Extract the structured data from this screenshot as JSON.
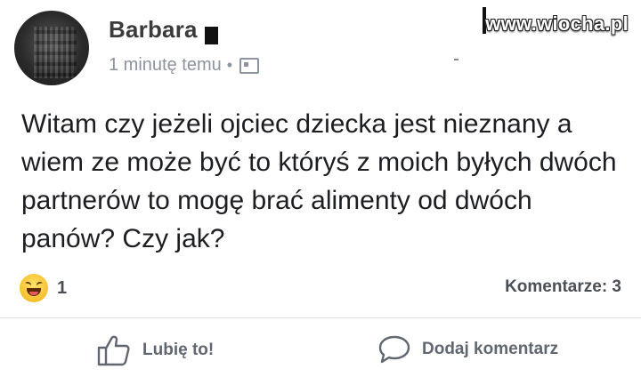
{
  "post": {
    "author": "Barbara",
    "timestamp": "1 minutę temu",
    "separator": "•",
    "audience_icon": "image-icon",
    "body": "Witam czy jeżeli ojciec dziecka jest nieznany a wiem ze może być to któryś z moich byłych dwóch partnerów to mogę brać alimenty od dwóch panów? Czy jak?",
    "watermark": "www.wiocha.pl"
  },
  "stats": {
    "reaction_icon": "haha-emoji-icon",
    "reaction_count": "1",
    "comments": "Komentarze: 3"
  },
  "actions": {
    "like_label": "Lubię to!",
    "like_icon": "thumbs-up-icon",
    "comment_label": "Dodaj komentarz",
    "comment_icon": "speech-bubble-icon"
  },
  "colors": {
    "text": "#1c1e21",
    "muted": "#8d949e",
    "action": "#606770",
    "divider": "#dadde1"
  }
}
